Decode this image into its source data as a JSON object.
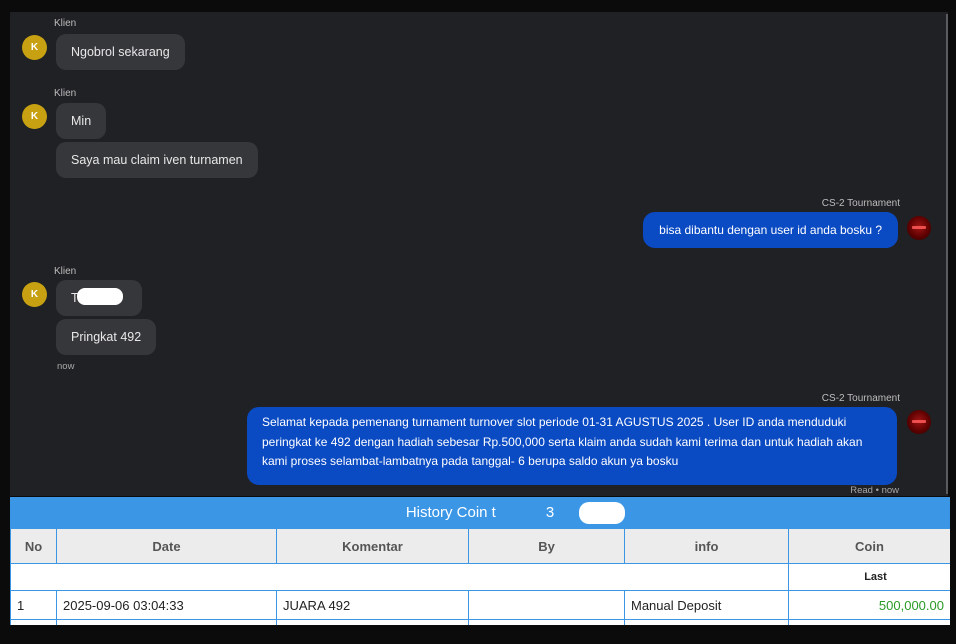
{
  "chat": {
    "messages": [
      {
        "sender": "Klien",
        "avatar": "K",
        "bubbles": [
          "Ngobrol sekarang"
        ]
      },
      {
        "sender": "Klien",
        "avatar": "K",
        "bubbles": [
          "Min",
          "Saya mau claim iven turnamen"
        ]
      },
      {
        "sender": "CS-2 Tournament",
        "bubbles": [
          "bisa dibantu dengan user id anda bosku ?"
        ]
      },
      {
        "sender": "Klien",
        "avatar": "K",
        "bubbles": [
          "T",
          "Pringkat 492"
        ],
        "time": "now"
      },
      {
        "sender": "CS-2 Tournament",
        "lines": [
          "Selamat kepada pemenang turnament turnover slot periode 01-31 AGUSTUS 2025 . User ID anda menduduki",
          "peringkat ke 492 dengan hadiah sebesar Rp.500,000 serta klaim anda sudah kami terima dan untuk hadiah akan",
          "kami proses selambat-lambatnya pada tanggal- 6 berupa saldo akun ya bosku"
        ],
        "status": "Read • now"
      }
    ]
  },
  "history": {
    "title": "History Coin t",
    "title_suffix": "3",
    "columns": [
      "No",
      "Date",
      "Komentar",
      "By",
      "info",
      "Coin"
    ],
    "subheader": "Last",
    "rows": [
      {
        "no": "1",
        "date": "2025-09-06 03:04:33",
        "komentar": "JUARA 492",
        "by": "",
        "info": "Manual Deposit",
        "coin": "500,000.00"
      }
    ]
  },
  "colors": {
    "outgoing_bubble": "#0a4ac3",
    "incoming_bubble": "#36373b",
    "table_header": "#3b97e6",
    "coin_positive": "#2a9a28"
  }
}
